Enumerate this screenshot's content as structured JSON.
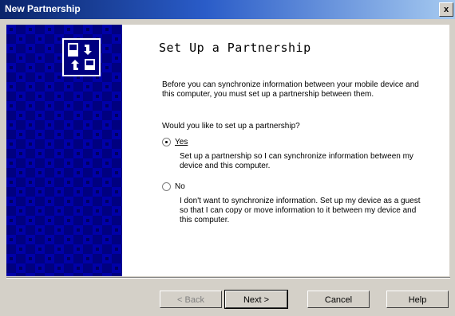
{
  "window": {
    "title": "New Partnership",
    "close_glyph": "x"
  },
  "heading": "Set Up a Partnership",
  "intro": "Before you can synchronize information between your mobile device and this computer, you must set up a partnership between them.",
  "question": "Would you like to set up a partnership?",
  "options": [
    {
      "label": "Yes",
      "selected": true,
      "description": "Set up a partnership so I can synchronize information between my device and this computer."
    },
    {
      "label": "No",
      "selected": false,
      "description": "I don't want to synchronize information. Set up my device as a guest so that I can copy or move information to it between my device and this computer."
    }
  ],
  "buttons": {
    "back": "< Back",
    "next": "Next >",
    "cancel": "Cancel",
    "help": "Help"
  },
  "colors": {
    "side_panel": "#000080",
    "title_start": "#0a246a"
  }
}
